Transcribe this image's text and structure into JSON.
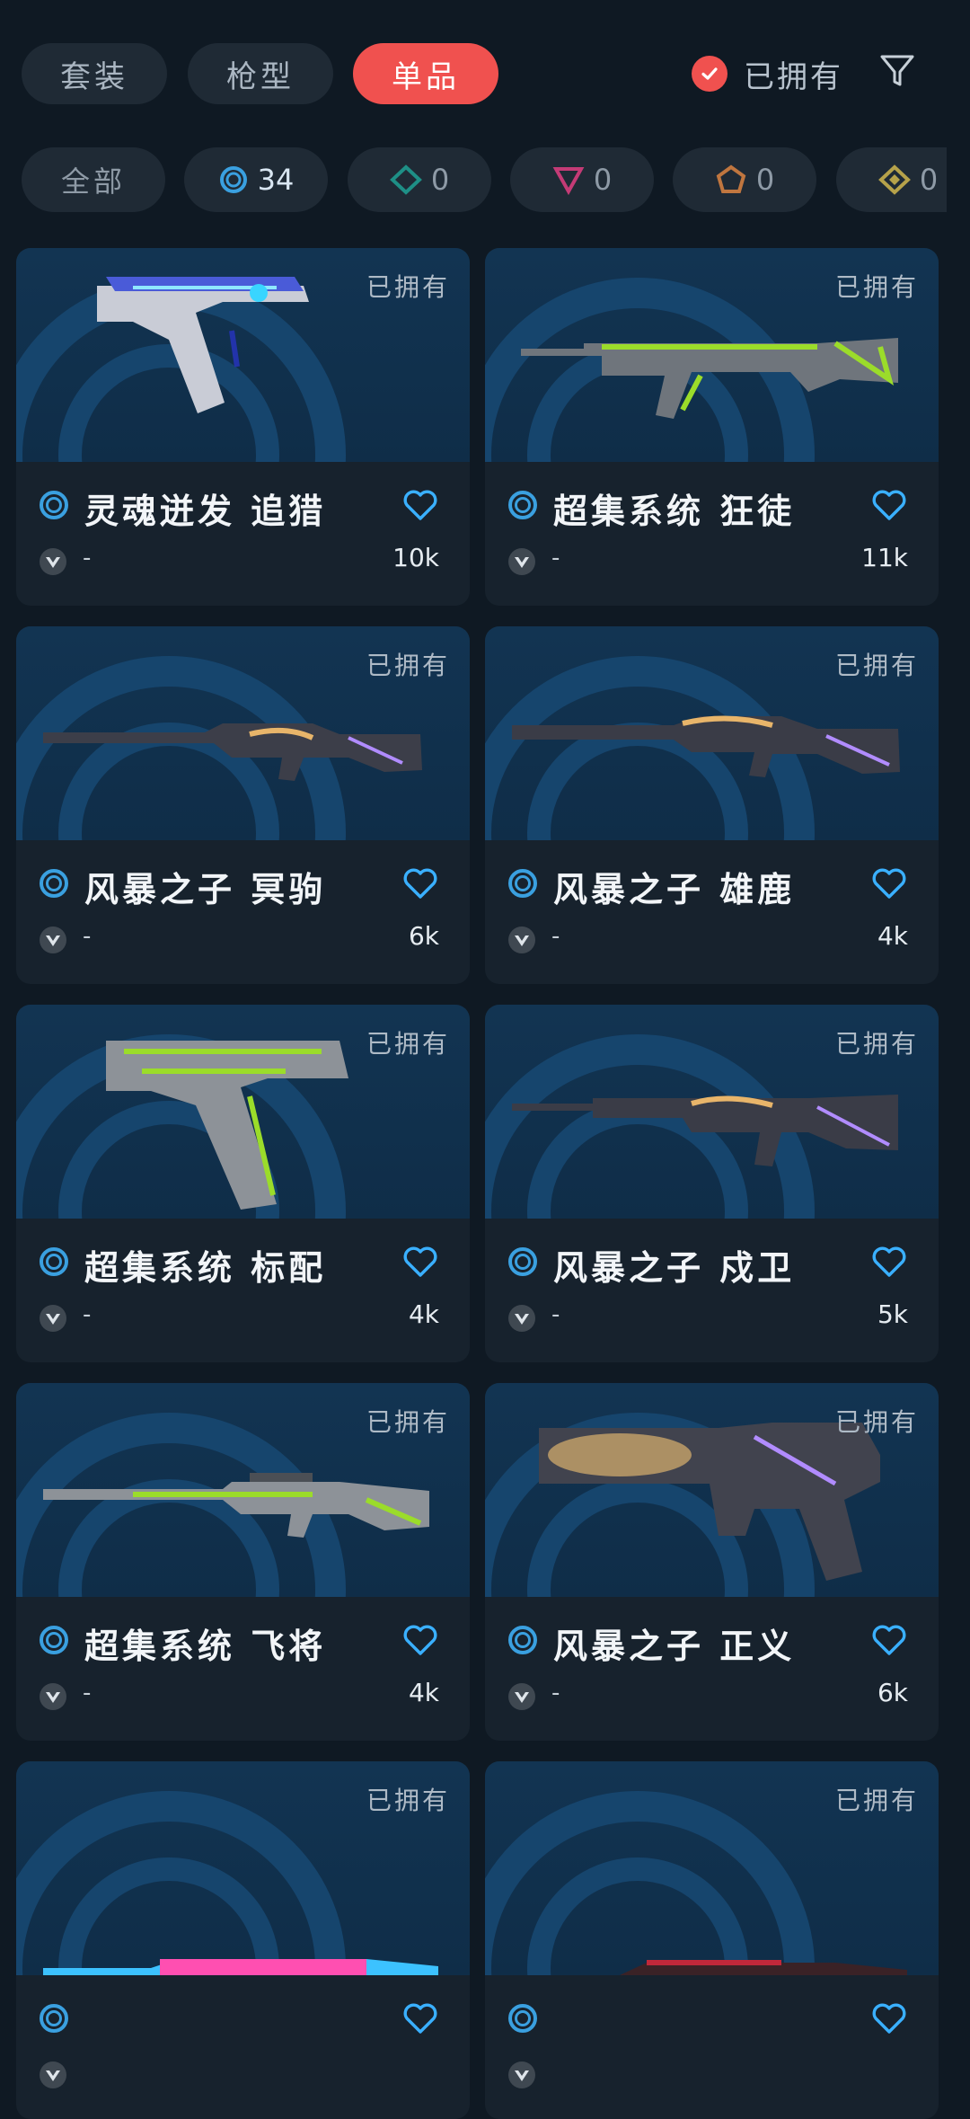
{
  "tabs": [
    {
      "label": "套装",
      "active": false
    },
    {
      "label": "枪型",
      "active": false
    },
    {
      "label": "单品",
      "active": true
    }
  ],
  "owned_filter": {
    "label": "已拥有",
    "checked": true
  },
  "filter_icon": "funnel-icon",
  "rarity_chips": [
    {
      "label": "全部"
    },
    {
      "icon": "ring-tier-icon",
      "count": "34",
      "color": "#3aa0e0"
    },
    {
      "icon": "diamond-tier-icon",
      "count": "0",
      "color": "#1e8f86"
    },
    {
      "icon": "triangle-tier-icon",
      "count": "0",
      "color": "#c43b76"
    },
    {
      "icon": "pentagon-tier-icon",
      "count": "0",
      "color": "#c0763f"
    },
    {
      "icon": "rhombus-tier-icon",
      "count": "0",
      "color": "#b6a24a"
    }
  ],
  "items": [
    {
      "name": "灵魂迸发 追猎",
      "owned": "已拥有",
      "rank": "-",
      "likes": "10k",
      "weapon": "pistol-blue"
    },
    {
      "name": "超集系统 狂徒",
      "owned": "已拥有",
      "rank": "-",
      "likes": "11k",
      "weapon": "rifle-green"
    },
    {
      "name": "风暴之子 冥驹",
      "owned": "已拥有",
      "rank": "-",
      "likes": "6k",
      "weapon": "sniper-dark"
    },
    {
      "name": "风暴之子 雄鹿",
      "owned": "已拥有",
      "rank": "-",
      "likes": "4k",
      "weapon": "shotgun-dark"
    },
    {
      "name": "超集系统 标配",
      "owned": "已拥有",
      "rank": "-",
      "likes": "4k",
      "weapon": "pistol-green"
    },
    {
      "name": "风暴之子 戍卫",
      "owned": "已拥有",
      "rank": "-",
      "likes": "5k",
      "weapon": "rifle-dark"
    },
    {
      "name": "超集系统 飞将",
      "owned": "已拥有",
      "rank": "-",
      "likes": "4k",
      "weapon": "sniper-green"
    },
    {
      "name": "风暴之子 正义",
      "owned": "已拥有",
      "rank": "-",
      "likes": "6k",
      "weapon": "revolver-dark"
    },
    {
      "name": "",
      "owned": "已拥有",
      "rank": "",
      "likes": "",
      "weapon": "rifle-pink"
    },
    {
      "name": "",
      "owned": "已拥有",
      "rank": "",
      "likes": "",
      "weapon": "rifle-red"
    }
  ],
  "colors": {
    "accent": "#f0514f",
    "heart": "#3ab0ff",
    "background": "#0f1923",
    "card": "#17222d"
  }
}
